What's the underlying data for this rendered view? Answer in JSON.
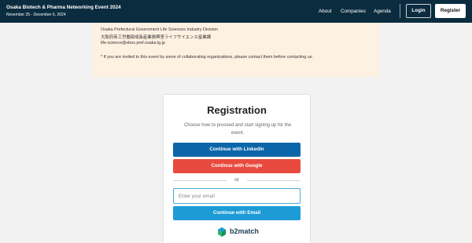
{
  "header": {
    "event_title": "Osaka Biotech & Pharma Networking Event 2024",
    "event_dates": "November 25 - December 6, 2024",
    "nav": [
      "About",
      "Companies",
      "Agenda"
    ],
    "login_label": "Login",
    "register_label": "Register"
  },
  "info": {
    "line1": "Osaka Prefectural Government Life Sciences Industry Division",
    "line2": "大阪府商工労働部成長産業振興室ライフサイエンス産業課",
    "line3": "life-science@sbox.pref.osaka.lg.jp",
    "line4": "* If you are invited to this event by some of collaborating organizations, please contact them before contacting us."
  },
  "registration": {
    "title": "Registration",
    "subtitle": "Choose how to proceed and start signing up for the event.",
    "linkedin_label": "Continue with LinkedIn",
    "google_label": "Continue with Google",
    "or_label": "or",
    "email_placeholder": "Enter your email",
    "email_value": "",
    "email_button_label": "Continue with Email",
    "brand_name": "b2match"
  },
  "colors": {
    "header_bg": "#0b2c3f",
    "info_bg": "#fdf1e2",
    "linkedin": "#0a66a8",
    "google": "#e84a3e",
    "email": "#1c9bd6",
    "brand_green": "#2bb673",
    "brand_blue": "#1c9bd6"
  },
  "icons": [
    "b2match-logo-icon"
  ]
}
